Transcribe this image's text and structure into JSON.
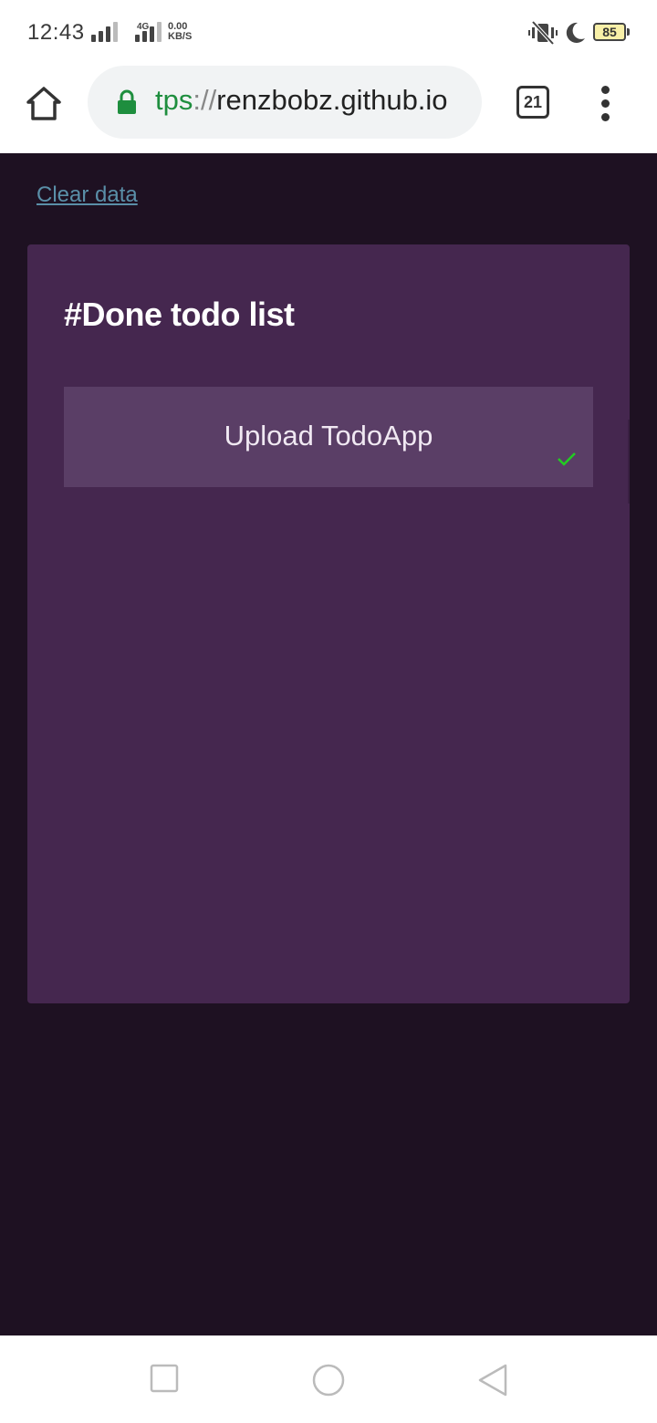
{
  "status_bar": {
    "time": "12:43",
    "network": "4G",
    "speed_value": "0.00",
    "speed_unit": "KB/S",
    "battery": "85"
  },
  "browser": {
    "url_scheme": "tps",
    "url_sep": "://",
    "url_host": "renzbobz.github.io",
    "tab_count": "21"
  },
  "page": {
    "clear_link": "Clear data",
    "card_title": "#Done todo list",
    "items": [
      {
        "text": "Upload TodoApp",
        "done": true
      }
    ]
  },
  "colors": {
    "page_bg": "#1e1122",
    "card_bg": "#45274f",
    "item_bg": "#5a3e66",
    "link": "#5a8fa8",
    "check": "#22cc22",
    "lock": "#1e8e3e"
  },
  "icons": {
    "home": "home-icon",
    "lock": "lock-icon",
    "menu": "more-vert-icon",
    "check": "check-icon",
    "vibrate": "vibrate-icon",
    "moon": "moon-icon",
    "nav_recent": "square-icon",
    "nav_home": "circle-icon",
    "nav_back": "triangle-back-icon"
  }
}
